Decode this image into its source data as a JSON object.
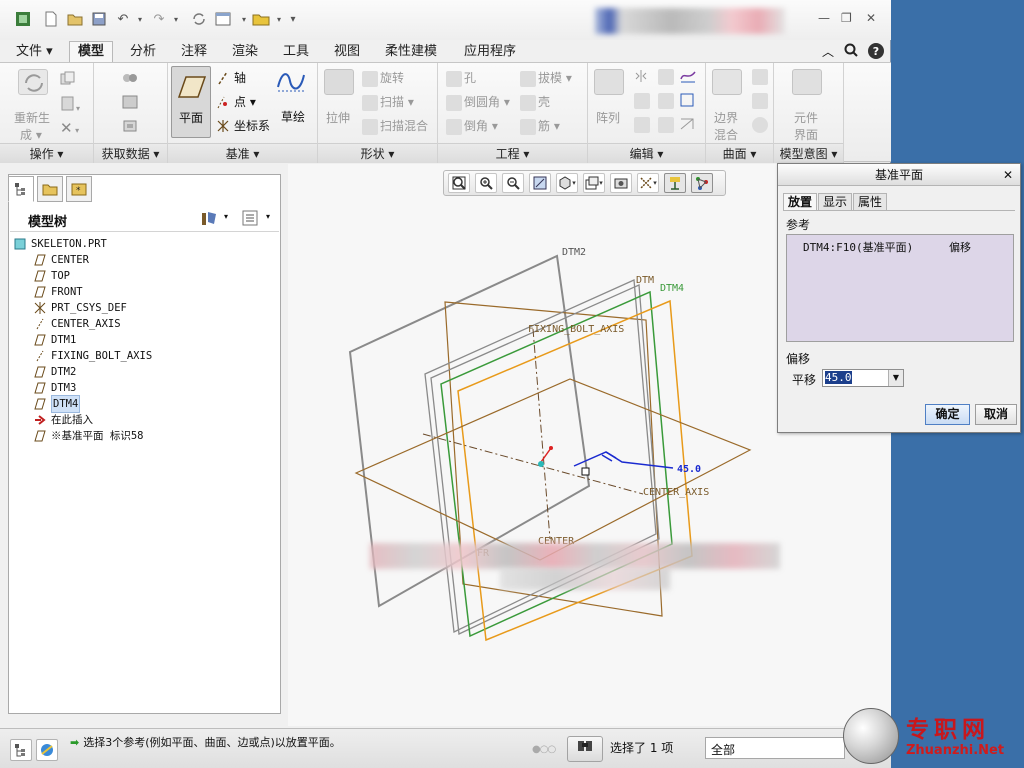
{
  "quick_access": {
    "icons": [
      "new-icon",
      "open-icon",
      "save-icon",
      "undo-icon",
      "redo-icon",
      "regenerate-icon",
      "windows-icon",
      "close-icon",
      "customize-icon"
    ]
  },
  "tabs": [
    {
      "label": "文件 ▾"
    },
    {
      "label": "模型"
    },
    {
      "label": "分析"
    },
    {
      "label": "注释"
    },
    {
      "label": "渲染"
    },
    {
      "label": "工具"
    },
    {
      "label": "视图"
    },
    {
      "label": "柔性建模"
    },
    {
      "label": "应用程序"
    }
  ],
  "ribbon": {
    "operations": {
      "regen_l1": "重新生",
      "regen_l2": "成 ▾",
      "footer": "操作 ▾"
    },
    "get_data": {
      "footer": "获取数据 ▾"
    },
    "datum": {
      "plane": "平面",
      "axis": "轴",
      "point": "点 ▾",
      "csys": "坐标系",
      "sketch": "草绘",
      "footer": "基准 ▾"
    },
    "shapes": {
      "extrude": "拉伸",
      "revolve": "旋转",
      "sweep": "扫描 ▾",
      "swept_blend": "扫描混合",
      "footer": "形状 ▾"
    },
    "engineering": {
      "hole": "孔",
      "round": "倒圆角 ▾",
      "chamfer": "倒角 ▾",
      "draft": "拔模 ▾",
      "shell": "壳",
      "rib": "筋 ▾",
      "footer": "工程 ▾"
    },
    "editing": {
      "pattern": "阵列",
      "footer": "编辑 ▾"
    },
    "surfaces": {
      "boundary_l1": "边界",
      "boundary_l2": "混合",
      "footer": "曲面 ▾"
    },
    "model_intent": {
      "component_l1": "元件",
      "component_l2": "界面",
      "footer": "模型意图 ▾"
    }
  },
  "model_tree": {
    "header": "模型树",
    "items": [
      {
        "label": "SKELETON.PRT",
        "icon": "part-icon",
        "indent": 0
      },
      {
        "label": "CENTER",
        "icon": "datum-plane-icon",
        "indent": 1
      },
      {
        "label": "TOP",
        "icon": "datum-plane-icon",
        "indent": 1
      },
      {
        "label": "FRONT",
        "icon": "datum-plane-icon",
        "indent": 1
      },
      {
        "label": "PRT_CSYS_DEF",
        "icon": "csys-icon",
        "indent": 1
      },
      {
        "label": "CENTER_AXIS",
        "icon": "axis-icon",
        "indent": 1
      },
      {
        "label": "DTM1",
        "icon": "datum-plane-icon",
        "indent": 1
      },
      {
        "label": "FIXING_BOLT_AXIS",
        "icon": "axis-icon",
        "indent": 1
      },
      {
        "label": "DTM2",
        "icon": "datum-plane-icon",
        "indent": 1
      },
      {
        "label": "DTM3",
        "icon": "datum-plane-icon",
        "indent": 1
      },
      {
        "label": "DTM4",
        "icon": "datum-plane-icon",
        "indent": 1,
        "selected": true
      },
      {
        "label": "在此插入",
        "icon": "insert-here-icon",
        "indent": 1
      },
      {
        "label": "※基准平面 标识58",
        "icon": "datum-plane-icon",
        "indent": 1
      }
    ]
  },
  "graphics": {
    "labels": {
      "dtm2": "DTM2",
      "dtm4": "DTM4",
      "dtm_partial": "DTM",
      "fixing_bolt_axis": "FIXING_BOLT_AXIS",
      "center_axis": "CENTER_AXIS",
      "center": "CENTER",
      "offset_value": "45.0",
      "front_partial": "FR"
    },
    "colors": {
      "dtm4_plane": "#3a9a3a",
      "new_plane": "#e89a1a",
      "brown_plane": "#9a6a2a",
      "grey_plane": "#8a8a8a",
      "dimension": "#1a2ad0"
    }
  },
  "dialog": {
    "title": "基准平面",
    "tabs": [
      "放置",
      "显示",
      "属性"
    ],
    "references_label": "参考",
    "reference": {
      "name": "DTM4:F10(基准平面)",
      "constraint": "偏移"
    },
    "offset_label": "偏移",
    "translate_label": "平移",
    "offset_value": "45.0",
    "ok": "确定",
    "cancel": "取消"
  },
  "status_bar": {
    "message": "选择3个参考(例如平面、曲面、边或点)以放置平面。",
    "selection": "选择了 1 项",
    "filter": "全部"
  },
  "watermark": {
    "cn": "专职网",
    "en": "Zhuanzhi.Net"
  }
}
